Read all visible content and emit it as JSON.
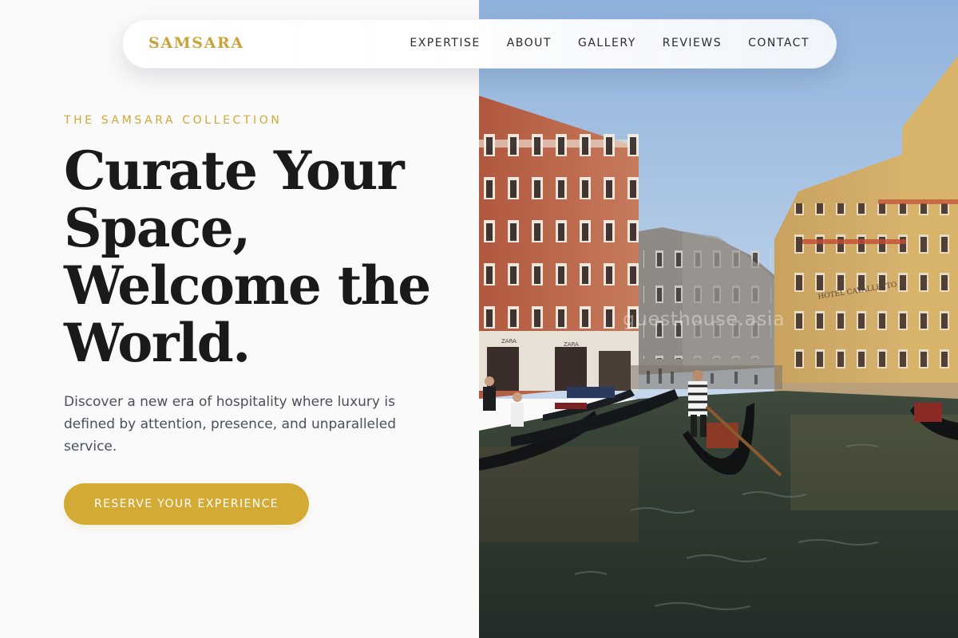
{
  "nav": {
    "brand": "SAMSARA",
    "links": [
      "EXPERTISE",
      "ABOUT",
      "GALLERY",
      "REVIEWS",
      "CONTACT"
    ]
  },
  "hero": {
    "eyebrow": "THE SAMSARA COLLECTION",
    "headline_lines": [
      "Curate Your",
      "Space,",
      "Welcome the",
      "World."
    ],
    "lede": "Discover a new era of hospitality where luxury is defined by attention, presence, and unparalleled service.",
    "cta_label": "RESERVE YOUR EXPERIENCE"
  },
  "image": {
    "shop_signs": [
      "ZARA",
      "ZARA"
    ],
    "hotel_sign": "HOTEL CAVALLETTO",
    "watermark": "guesthouse.asia"
  },
  "colors": {
    "accent": "#d3aa34",
    "brand": "#c9a43a",
    "text_dark": "#1a1a1a",
    "text_muted": "#4a4f5a",
    "background": "#fafafa"
  }
}
